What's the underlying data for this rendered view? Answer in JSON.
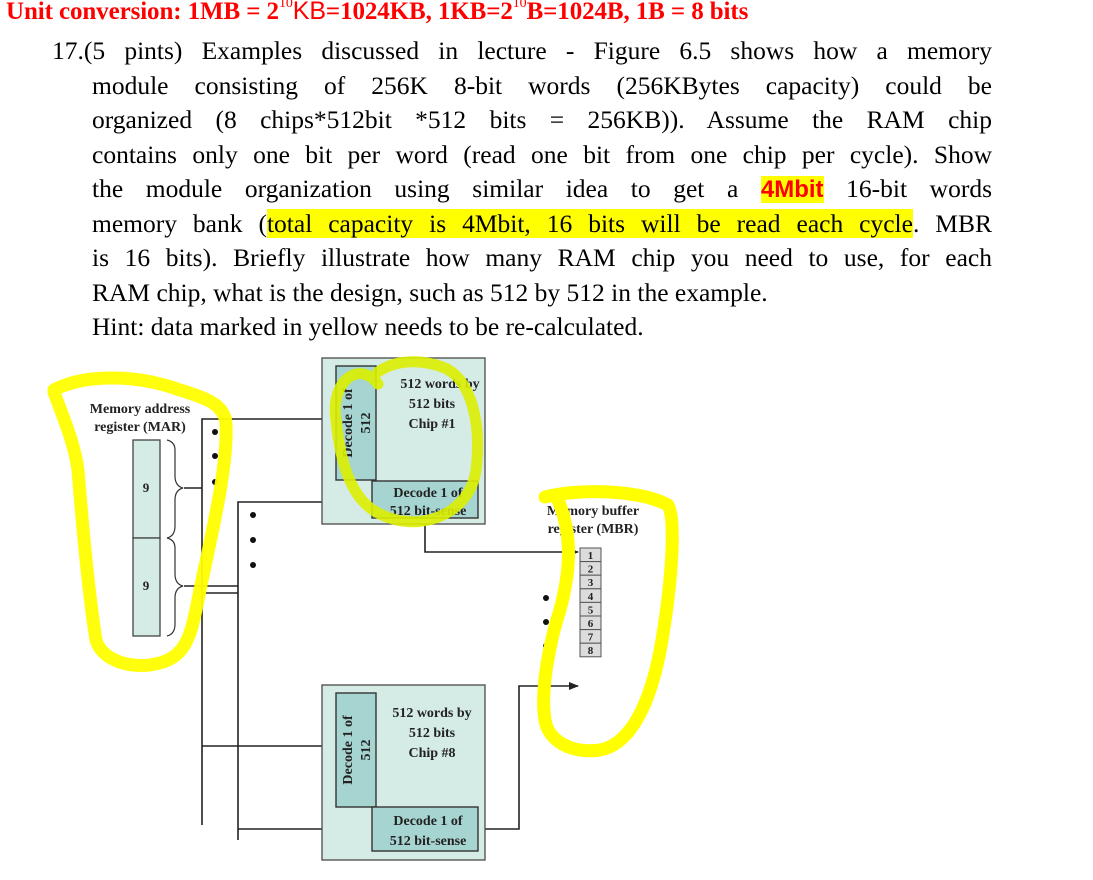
{
  "unit_conversion": {
    "prefix": "Unit conversion: 1MB = 2",
    "exp1": "10",
    "kb_part": "KB",
    "after_kb": "=1024KB, 1KB=2",
    "exp2": "10",
    "tail": "B=1024B, 1B = 8 bits"
  },
  "question": {
    "line1": "17.(5 pints) Examples discussed in lecture - Figure 6.5 shows how a memory",
    "line2": "module consisting of 256K 8-bit words (256KBytes capacity) could be",
    "line3": "organized (8 chips*512bit *512 bits = 256KB)). Assume the RAM chip",
    "line4": "contains only one bit per word (read one bit from one chip per cycle). Show",
    "line5_pre": "the module organization using similar idea to get a",
    "line5_highlight": "4Mbit",
    "line5_post": "16-bit words",
    "line6_pre": "memory bank (",
    "line6_highlight": "total capacity is 4Mbit, 16 bits will be read each cycle",
    "line6_post": ". MBR",
    "line7": "is 16 bits). Briefly illustrate how many RAM chip you need to use, for each",
    "line8": "RAM chip, what is the design, such as 512 by 512 in the example.",
    "line9": "Hint: data marked in yellow needs to be re-calculated."
  },
  "diagram": {
    "mar_label_1": "Memory address",
    "mar_label_2": "register (MAR)",
    "mar_fields": [
      "9",
      "9"
    ],
    "chips": [
      {
        "title_1": "512 words by",
        "title_2": "512 bits",
        "title_3": "Chip #1",
        "row_decoder_1": "Decode 1 of",
        "row_decoder_2": "512",
        "col_decoder_1": "Decode 1 of",
        "col_decoder_2": "512 bit-sense"
      },
      {
        "title_1": "512 words by",
        "title_2": "512 bits",
        "title_3": "Chip #8",
        "row_decoder_1": "Decode 1 of",
        "row_decoder_2": "512",
        "col_decoder_1": "Decode 1 of",
        "col_decoder_2": "512 bit-sense"
      }
    ],
    "mbr_label_1": "Memory buffer",
    "mbr_label_2": "register (MBR)",
    "mbr_cells": [
      "1",
      "2",
      "3",
      "4",
      "5",
      "6",
      "7",
      "8"
    ]
  },
  "colors": {
    "heading_red": "#ff0000",
    "highlight_yellow": "#ffff00",
    "chip_fill": "#d5ebe6",
    "decoder_fill": "#a6d4d0",
    "mbr_fill": "#dcdcdc",
    "annotation_yellow": "#ffff00"
  }
}
